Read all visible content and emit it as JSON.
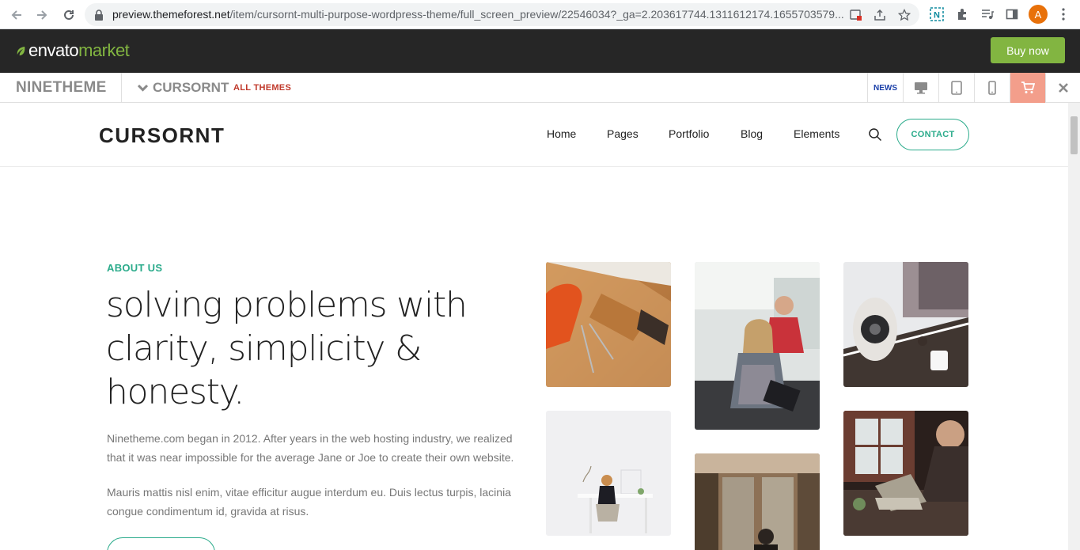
{
  "browser": {
    "url_host": "preview.themeforest.net",
    "url_path": "/item/cursornt-multi-purpose-wordpress-theme/full_screen_preview/22546034?_ga=2.203617744.1311612174.1655703579...",
    "avatar_letter": "A"
  },
  "envato": {
    "logo_main": "envato",
    "logo_market": "market",
    "buy_label": "Buy now"
  },
  "preview_bar": {
    "brand": "NINETHEME",
    "theme_name": "CURSORNT",
    "all_themes": "ALL THEMES",
    "news": "NEWS"
  },
  "site": {
    "logo": "CURSORNT",
    "menu": [
      "Home",
      "Pages",
      "Portfolio",
      "Blog",
      "Elements"
    ],
    "contact": "CONTACT",
    "about_label": "ABOUT US",
    "headline_lines": [
      "solving problems with",
      "clarity, simplicity &",
      "honesty."
    ],
    "paragraph1": "Ninetheme.com began in 2012. After years in the web hosting industry, we realized that it was near impossible for the average Jane or Joe to create their own website.",
    "paragraph2": "Mauris mattis nisl enim, vitae efficitur augue interdum eu. Duis lectus turpis, lacinia congue condimentum id, gravida at risus."
  },
  "colors": {
    "accent": "#2bab8b",
    "envato_green": "#82b541",
    "envato_bar": "#262626",
    "cart": "#f39e8b",
    "all_themes": "#c0392b"
  }
}
